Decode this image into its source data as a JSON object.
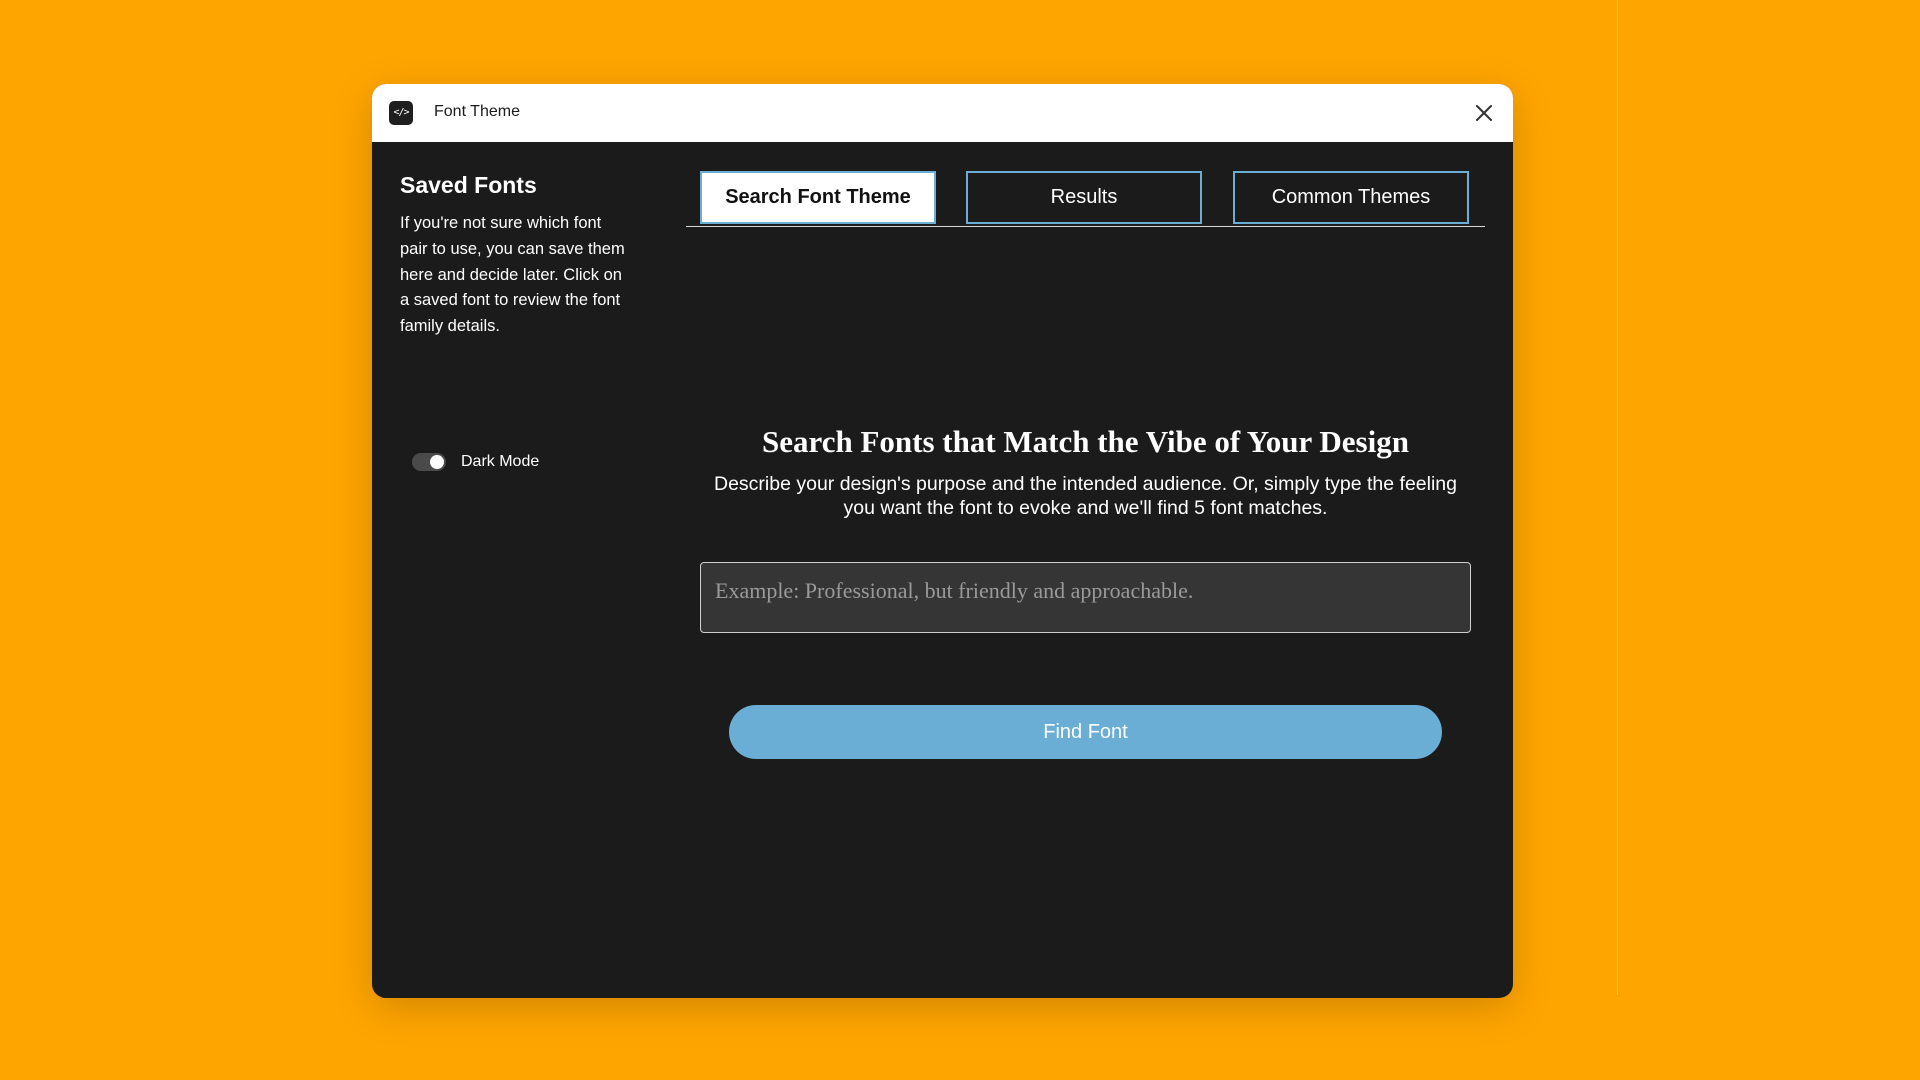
{
  "window": {
    "title": "Font Theme",
    "icon": "code-icon",
    "icon_glyph": "</>"
  },
  "sidebar": {
    "title": "Saved Fonts",
    "description": "If you're not sure which font pair to use, you can save them here and decide later. Click on a saved font to review the font family details.",
    "toggle": {
      "label": "Dark Mode",
      "on": true
    }
  },
  "tabs": [
    {
      "label": "Search Font Theme",
      "active": true
    },
    {
      "label": "Results",
      "active": false
    },
    {
      "label": "Common Themes",
      "active": false
    }
  ],
  "main": {
    "heading": "Search Fonts that Match the Vibe of Your Design",
    "subtext": "Describe your design's purpose and the intended audience. Or, simply type the feeling you want the font to evoke and we'll find 5 font matches.",
    "search": {
      "value": "",
      "placeholder": "Example: Professional, but friendly and approachable."
    },
    "button_label": "Find Font"
  },
  "colors": {
    "background": "#FFA500",
    "panel": "#1b1b1b",
    "accent": "#6aaed6",
    "input_bg": "#353535"
  }
}
